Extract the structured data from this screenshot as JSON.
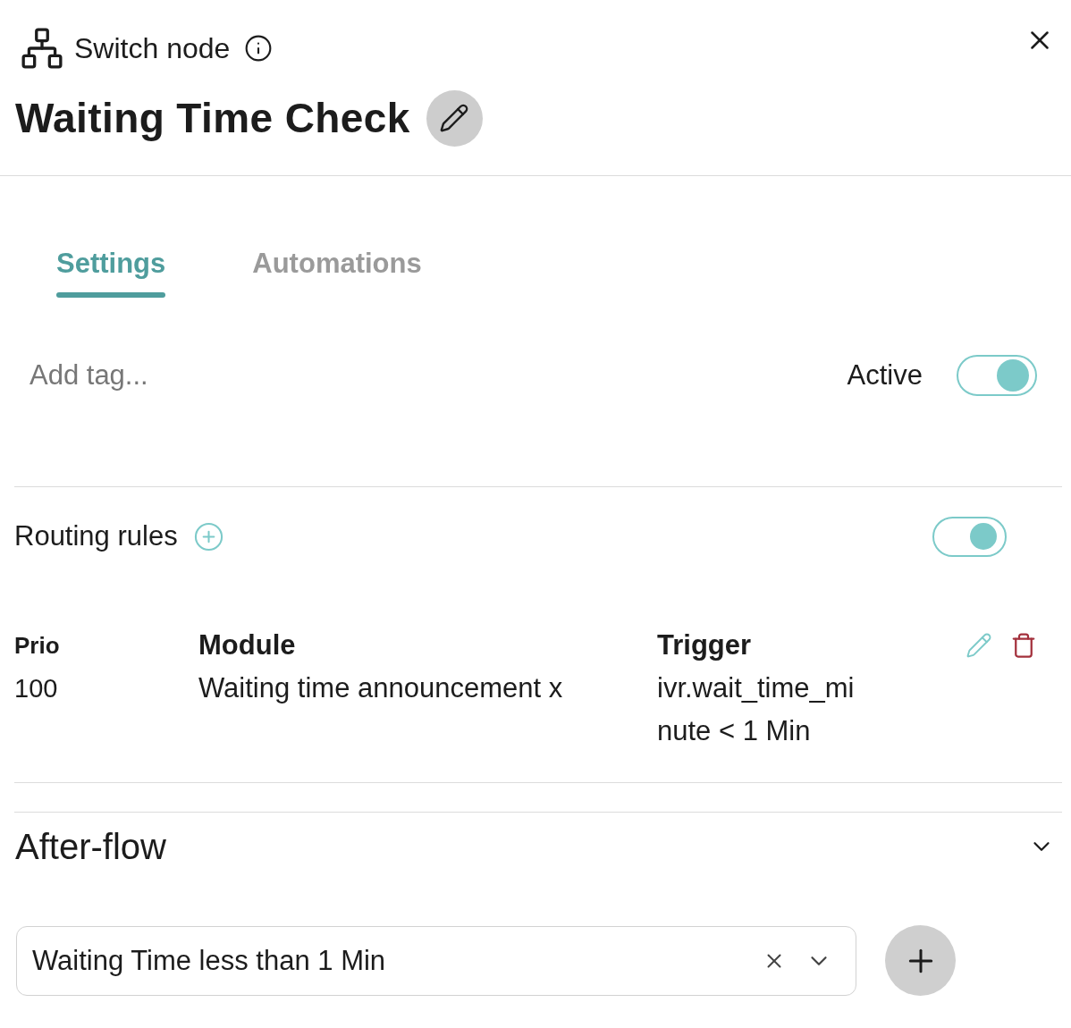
{
  "header": {
    "node_type": "Switch node",
    "title": "Waiting Time Check"
  },
  "tabs": [
    {
      "label": "Settings",
      "selected": true
    },
    {
      "label": "Automations",
      "selected": false
    }
  ],
  "tag_field": {
    "placeholder": "Add tag..."
  },
  "active_toggle": {
    "label": "Active",
    "on": true
  },
  "routing_rules": {
    "title": "Routing rules",
    "on": true,
    "columns": [
      "Prio",
      "Module",
      "Trigger"
    ],
    "rows": [
      {
        "prio": "100",
        "module": "Waiting time announcement x",
        "trigger": "ivr.wait_time_minute < 1 Min"
      }
    ]
  },
  "after_flow": {
    "title": "After-flow",
    "expanded": true,
    "select": {
      "value": "Waiting Time less than 1 Min"
    }
  }
}
